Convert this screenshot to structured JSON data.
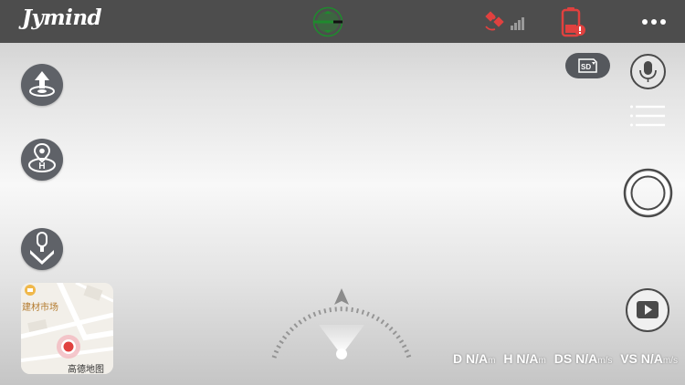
{
  "top_bar": {
    "brand": "Jymind",
    "icons": {
      "gimbal": "gimbal-level-icon",
      "satellite": "satellite-signal-icon",
      "battery": "battery-warning-icon",
      "more": "more-dots-icon"
    }
  },
  "left_controls": {
    "icons": [
      "takeoff-icon",
      "return-home-icon",
      "landing-icon"
    ]
  },
  "map": {
    "poi_label": "建材市场",
    "provider_label": "高德地图"
  },
  "right_controls": {
    "sd_label": "SD",
    "icons": [
      "microphone-icon",
      "menu-list-icon",
      "shutter-icon",
      "playback-icon"
    ]
  },
  "telemetry": {
    "distance": {
      "label": "D",
      "value": "N/A",
      "unit": "m"
    },
    "height": {
      "label": "H",
      "value": "N/A",
      "unit": "m"
    },
    "horizontal_speed": {
      "label": "DS",
      "value": "N/A",
      "unit": "m/s"
    },
    "vertical_speed": {
      "label": "VS",
      "value": "N/A",
      "unit": "m/s"
    }
  },
  "colors": {
    "top_bar": "#4d4d4d",
    "button": "#5f6268",
    "alert": "#e0413f",
    "gimbal_green": "#1f8a2e"
  }
}
